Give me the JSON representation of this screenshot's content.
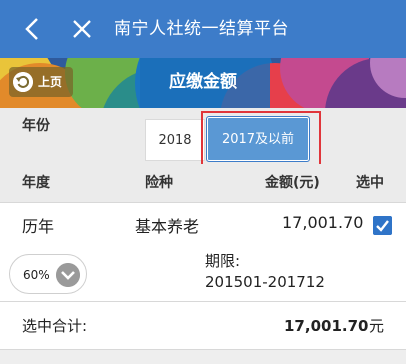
{
  "topbar": {
    "title": "南宁人社统一结算平台"
  },
  "banner": {
    "prev_label": "上页",
    "title": "应缴金额"
  },
  "year_selector": {
    "label": "年份",
    "options": [
      "2018",
      "2017及以前"
    ],
    "selected": "2017及以前"
  },
  "table": {
    "headers": [
      "年度",
      "险种",
      "金额(元)",
      "选中"
    ],
    "rows": [
      {
        "year": "历年",
        "type": "基本养老",
        "amount": "17,001.70",
        "checked": true,
        "percent": "60%",
        "period_label": "期限:",
        "period_value": "201501-201712"
      }
    ]
  },
  "total": {
    "label": "选中合计:",
    "value": "17,001.70",
    "unit": "元"
  },
  "colors": {
    "primary": "#3d7cc9",
    "highlight": "#e0353a",
    "selected": "#5a98d4"
  }
}
